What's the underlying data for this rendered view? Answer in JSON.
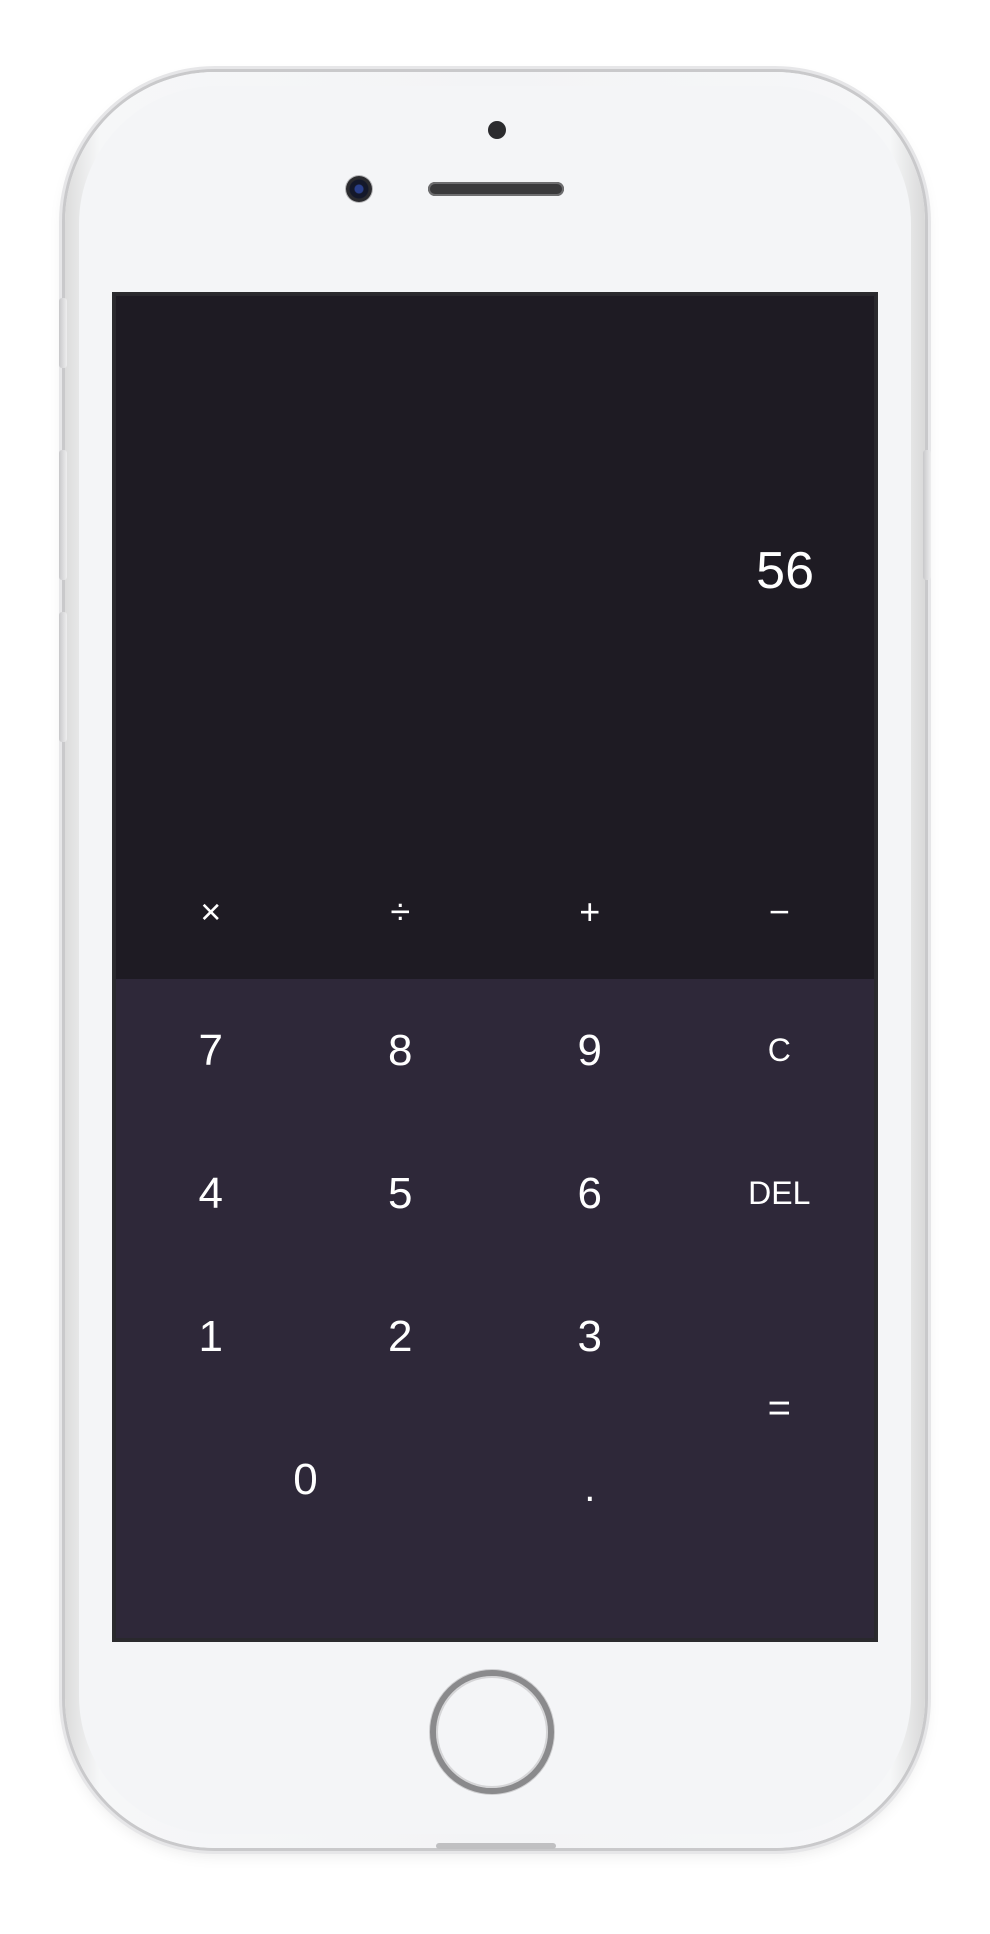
{
  "display": {
    "value": "56"
  },
  "operators": [
    {
      "symbol": "×",
      "name": "multiply"
    },
    {
      "symbol": "÷",
      "name": "divide"
    },
    {
      "symbol": "+",
      "name": "add"
    },
    {
      "symbol": "−",
      "name": "subtract"
    }
  ],
  "keypad": {
    "row1": [
      "7",
      "8",
      "9",
      "C"
    ],
    "row2": [
      "4",
      "5",
      "6",
      "DEL"
    ],
    "row3": [
      "1",
      "2",
      "3"
    ],
    "equals": "=",
    "zero": "0",
    "decimal": "."
  },
  "colors": {
    "display_bg": "#1e1b23",
    "keypad_bg": "#2e2839",
    "text": "#ffffff",
    "phone_body": "#f4f5f7"
  }
}
